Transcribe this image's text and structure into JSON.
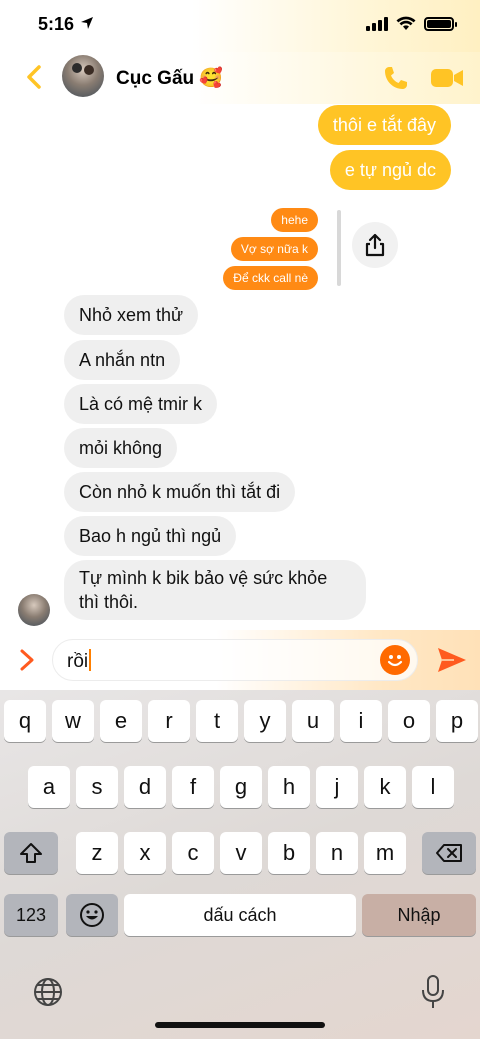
{
  "status_bar": {
    "time": "5:16"
  },
  "header": {
    "contact_name": "Cục Gấu 🥰"
  },
  "messages": {
    "outgoing": [
      "thôi e tắt đây",
      "e tự ngủ dc"
    ],
    "forwarded": [
      "hehe",
      "Vợ sợ nữa k",
      "Để ckk call nè"
    ],
    "incoming": [
      "Nhỏ xem thử",
      "A nhắn ntn",
      "Là có mệ tmir k",
      "mỏi không",
      "Còn nhỏ k muốn thì tắt đi",
      "Bao h ngủ thì ngủ",
      "Tự mình k bik bảo vệ sức khỏe",
      "thì thôi."
    ]
  },
  "composer": {
    "input_value": "rồi"
  },
  "keyboard": {
    "row1": [
      "q",
      "w",
      "e",
      "r",
      "t",
      "y",
      "u",
      "i",
      "o",
      "p"
    ],
    "row2": [
      "a",
      "s",
      "d",
      "f",
      "g",
      "h",
      "j",
      "k",
      "l"
    ],
    "row3": [
      "z",
      "x",
      "c",
      "v",
      "b",
      "n",
      "m"
    ],
    "numbers_label": "123",
    "space_label": "dấu cách",
    "return_label": "Nhập"
  },
  "colors": {
    "accent_yellow": "#ffc425",
    "accent_orange": "#ff8a14",
    "incoming_bubble": "#efefef"
  },
  "icons": [
    "location-arrow-icon",
    "signal-icon",
    "wifi-icon",
    "battery-icon",
    "back-chevron-icon",
    "phone-icon",
    "video-icon",
    "share-icon",
    "expand-chevron-icon",
    "emoji-icon",
    "send-icon",
    "shift-icon",
    "backspace-icon",
    "emoji-keyboard-icon",
    "globe-icon",
    "microphone-icon"
  ]
}
